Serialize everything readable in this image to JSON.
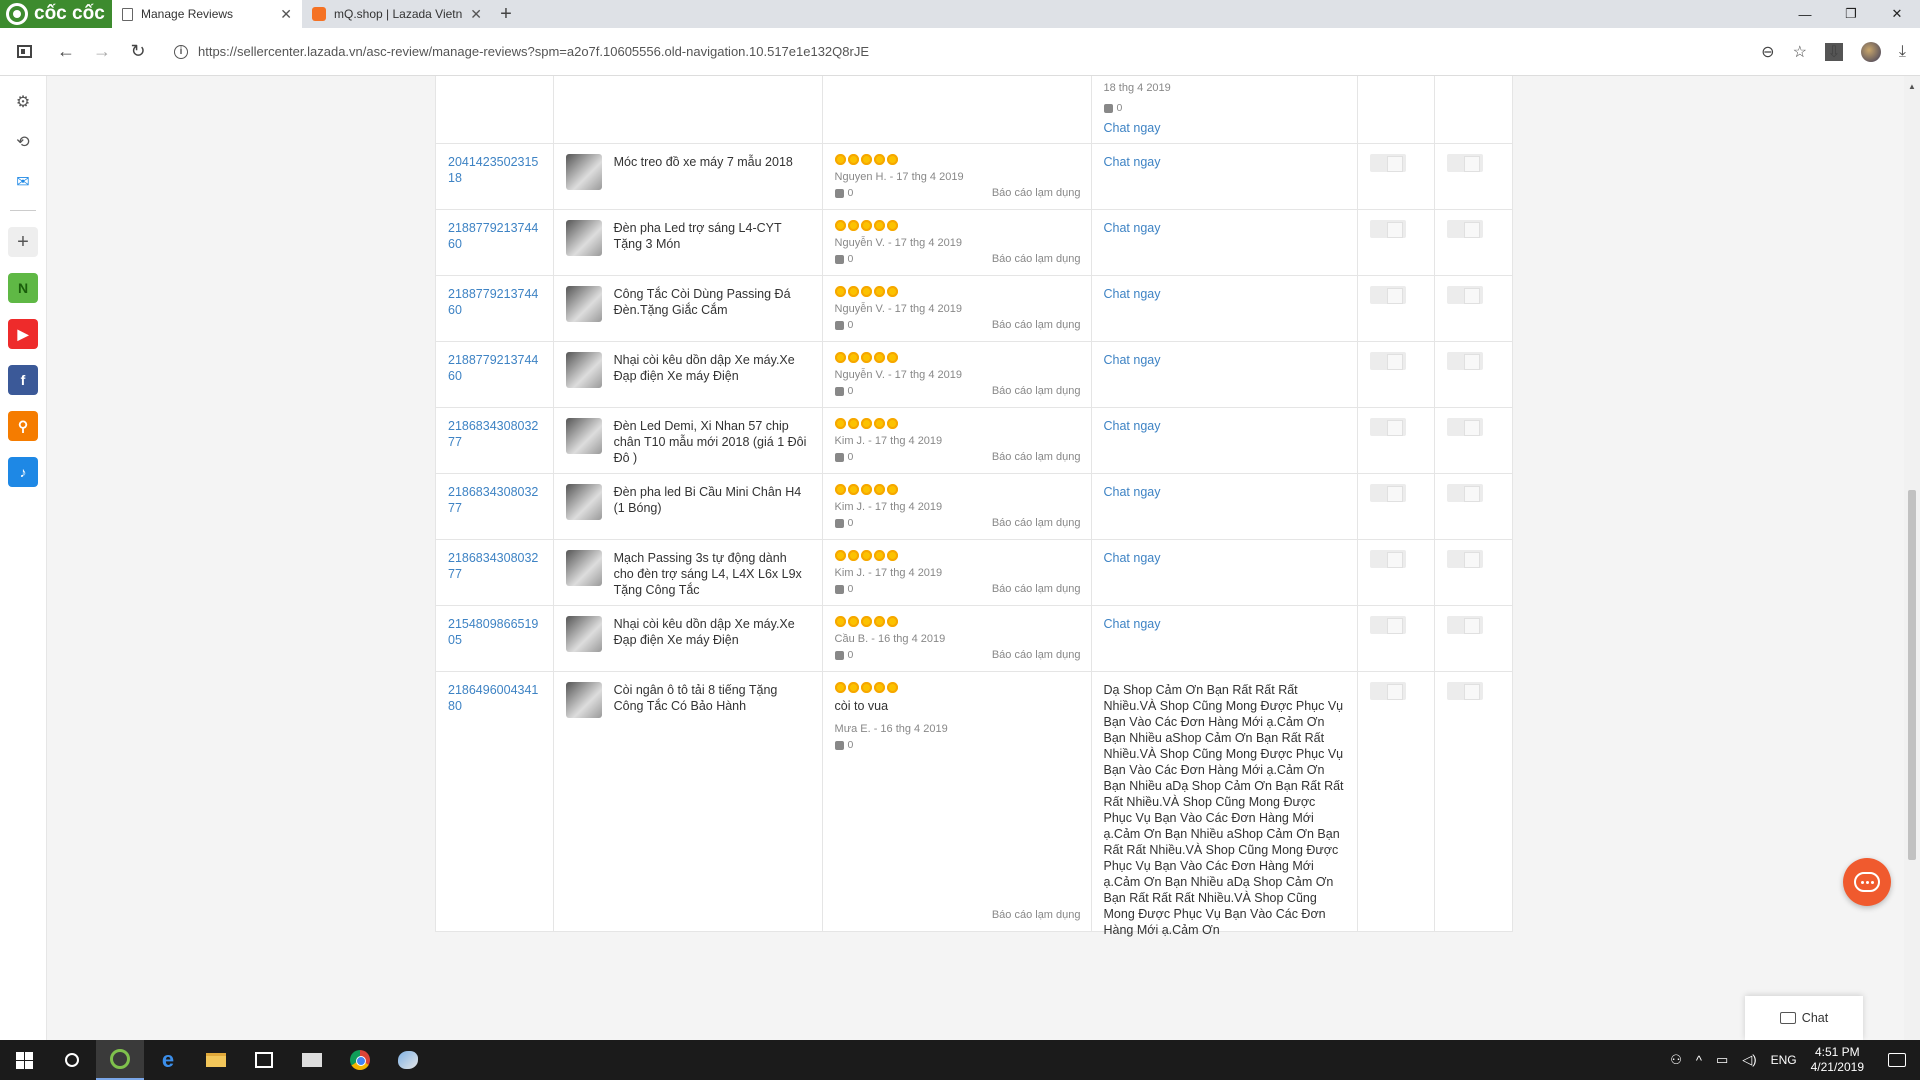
{
  "browser": {
    "brand": "cốc cốc",
    "tabs": [
      {
        "title": "Manage Reviews",
        "active": true
      },
      {
        "title": "mQ.shop | Lazada Vietnam",
        "active": false
      }
    ],
    "url": "https://sellercenter.lazada.vn/asc-review/manage-reviews?spm=a2o7f.10605556.old-navigation.10.517e1e132Q8rJE"
  },
  "sidebar": {
    "tiles": [
      "N"
    ]
  },
  "reviews": {
    "top_partial": {
      "date": "18 thg 4 2019",
      "likes": "0",
      "chat_label": "Chat ngay"
    },
    "report_label": "Báo cáo lạm dụng",
    "chat_label": "Chat ngay",
    "rows": [
      {
        "order_id": "204142350231518",
        "product": "Móc treo đồ xe máy 7 mẫu 2018",
        "review_text": "",
        "meta": "Nguyen H. - 17 thg 4 2019",
        "likes": "0",
        "reply": ""
      },
      {
        "order_id": "218877921374460",
        "product": "Đèn pha Led trợ sáng L4-CYT Tặng 3 Món",
        "review_text": "",
        "meta": "Nguyễn V. - 17 thg 4 2019",
        "likes": "0",
        "reply": ""
      },
      {
        "order_id": "218877921374460",
        "product": "Công Tắc Còi Dùng Passing Đá Đèn.Tặng Giắc Cắm",
        "review_text": "",
        "meta": "Nguyễn V. - 17 thg 4 2019",
        "likes": "0",
        "reply": ""
      },
      {
        "order_id": "218877921374460",
        "product": "Nhại còi kêu dồn dập Xe máy.Xe Đạp điện Xe máy Điện",
        "review_text": "",
        "meta": "Nguyễn V. - 17 thg 4 2019",
        "likes": "0",
        "reply": ""
      },
      {
        "order_id": "218683430803277",
        "product": "Đèn Led Demi, Xi Nhan 57 chip chân T10 mẫu mới 2018 (giá 1 Đôi Đô )",
        "review_text": "",
        "meta": "Kim J. - 17 thg 4 2019",
        "likes": "0",
        "reply": ""
      },
      {
        "order_id": "218683430803277",
        "product": "Đèn pha led Bi Cầu Mini Chân H4 (1 Bóng)",
        "review_text": "",
        "meta": "Kim J. - 17 thg 4 2019",
        "likes": "0",
        "reply": ""
      },
      {
        "order_id": "218683430803277",
        "product": "Mạch Passing 3s tự động dành cho đèn trợ sáng L4, L4X L6x L9x Tặng Công Tắc",
        "review_text": "",
        "meta": "Kim J. - 17 thg 4 2019",
        "likes": "0",
        "reply": ""
      },
      {
        "order_id": "215480986651905",
        "product": "Nhại còi kêu dồn dập Xe máy.Xe Đạp điện Xe máy Điện",
        "review_text": "",
        "meta": "Cầu B. - 16 thg 4 2019",
        "likes": "0",
        "reply": ""
      },
      {
        "order_id": "218649600434180",
        "product": "Còi ngân ô tô tải 8 tiếng Tặng Công Tắc Có Bảo Hành",
        "review_text": "còi to vua",
        "meta": "Mưa E. - 16 thg 4 2019",
        "likes": "0",
        "reply": "Dạ Shop Cảm Ơn Bạn Rất Rất Rất Nhiều.VÀ Shop Cũng Mong Được Phục Vụ Bạn Vào Các Đơn Hàng Mới ạ.Cảm Ơn Bạn Nhiều aShop Cảm Ơn Bạn Rất Rất Nhiều.VÀ Shop Cũng Mong Được Phục Vụ Bạn Vào Các Đơn Hàng Mới ạ.Cảm Ơn Bạn Nhiều aDạ Shop Cảm Ơn Bạn Rất Rất Rất Nhiều.VÀ Shop Cũng Mong Được Phục Vụ Bạn Vào Các Đơn Hàng Mới ạ.Cảm Ơn Bạn Nhiều aShop Cảm Ơn Bạn Rất Rất Nhiều.VÀ Shop Cũng Mong Được Phục Vụ Bạn Vào Các Đơn Hàng Mới ạ.Cảm Ơn Bạn Nhiều aDạ Shop Cảm Ơn Bạn Rất Rất Rất Nhiều.VÀ Shop Cũng Mong Được Phục Vụ Bạn Vào Các Đơn Hàng Mới ạ.Cảm Ơn"
      }
    ]
  },
  "widgets": {
    "chat_box_label": "Chat"
  },
  "taskbar": {
    "lang": "ENG",
    "time": "4:51 PM",
    "date": "4/21/2019"
  },
  "colors": {
    "link": "#3e83c4",
    "star": "#fcc200",
    "brand_green": "#3d8b2e",
    "chat_orange": "#f05a2e"
  }
}
